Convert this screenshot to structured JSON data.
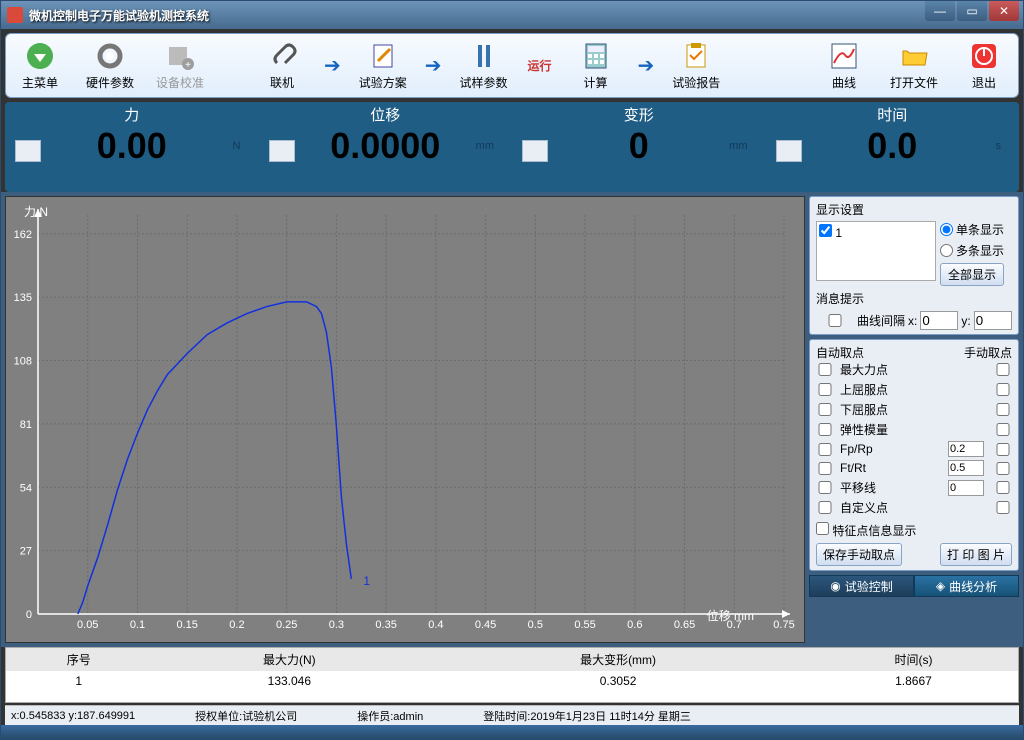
{
  "window": {
    "title": "微机控制电子万能试验机测控系统"
  },
  "toolbar": {
    "main_menu": "主菜单",
    "hw_param": "硬件参数",
    "calib": "设备校准",
    "connect": "联机",
    "plan": "试验方案",
    "sample": "试样参数",
    "run_tag": "运行",
    "calc": "计算",
    "report": "试验报告",
    "curve": "曲线",
    "open": "打开文件",
    "exit": "退出"
  },
  "meters": {
    "force": {
      "label": "力",
      "value": "0.00",
      "unit": "N",
      "sub": ""
    },
    "disp": {
      "label": "位移",
      "value": "0.0000",
      "unit": "mm",
      "sub": ""
    },
    "deform": {
      "label": "变形",
      "value": "0",
      "unit": "mm",
      "sub": ""
    },
    "time": {
      "label": "时间",
      "value": "0.0",
      "unit": "s",
      "sub": ""
    }
  },
  "chart_data": {
    "type": "line",
    "title": "",
    "xlabel": "位移  mm",
    "ylabel": "力 N",
    "xlim": [
      0,
      0.75
    ],
    "ylim": [
      0,
      170
    ],
    "xticks": [
      0.05,
      0.1,
      0.15,
      0.2,
      0.25,
      0.3,
      0.35,
      0.4,
      0.45,
      0.5,
      0.55,
      0.6,
      0.65,
      0.7,
      0.75
    ],
    "yticks": [
      0,
      27,
      54,
      81,
      108,
      135,
      162
    ],
    "series": [
      {
        "name": "1",
        "x": [
          0.04,
          0.045,
          0.05,
          0.06,
          0.07,
          0.08,
          0.09,
          0.1,
          0.11,
          0.12,
          0.13,
          0.15,
          0.17,
          0.19,
          0.21,
          0.23,
          0.25,
          0.27,
          0.28,
          0.285,
          0.29,
          0.295,
          0.3,
          0.305,
          0.31,
          0.315
        ],
        "y": [
          0,
          5,
          12,
          24,
          38,
          53,
          66,
          77,
          87,
          95,
          102,
          111,
          119,
          124,
          128,
          131,
          133,
          133,
          131,
          128,
          120,
          105,
          80,
          50,
          30,
          15
        ]
      }
    ],
    "curve_label": "1"
  },
  "display_settings": {
    "title": "显示设置",
    "series_item": "1",
    "radio_single": "单条显示",
    "radio_multi": "多条显示",
    "btn_all": "全部显示",
    "msg_title": "消息提示",
    "offset_label": "曲线间隔",
    "offset_x_label": "x:",
    "offset_x": "0",
    "offset_y_label": "y:",
    "offset_y": "0"
  },
  "pick": {
    "auto_header": "自动取点",
    "manual_header": "手动取点",
    "rows": [
      {
        "label": "最大力点",
        "val": ""
      },
      {
        "label": "上屈服点",
        "val": ""
      },
      {
        "label": "下屈服点",
        "val": ""
      },
      {
        "label": "弹性模量",
        "val": ""
      },
      {
        "label": "Fp/Rp",
        "val": "0.2"
      },
      {
        "label": "Ft/Rt",
        "val": "0.5"
      },
      {
        "label": "平移线",
        "val": "0"
      },
      {
        "label": "自定义点",
        "val": ""
      }
    ],
    "feature_show": "特征点信息显示",
    "btn_save": "保存手动取点",
    "btn_print": "打 印 图 片"
  },
  "tabs": {
    "control": "试验控制",
    "curve": "曲线分析"
  },
  "table": {
    "headers": [
      "序号",
      "最大力(N)",
      "最大变形(mm)",
      "时间(s)"
    ],
    "rows": [
      [
        "1",
        "133.046",
        "0.3052",
        "1.8667"
      ]
    ]
  },
  "status": {
    "coord": "x:0.545833 y:187.649991",
    "auth": "授权单位:试验机公司",
    "operator": "操作员:admin",
    "login": "登陆时间:2019年1月23日 11时14分 星期三"
  }
}
